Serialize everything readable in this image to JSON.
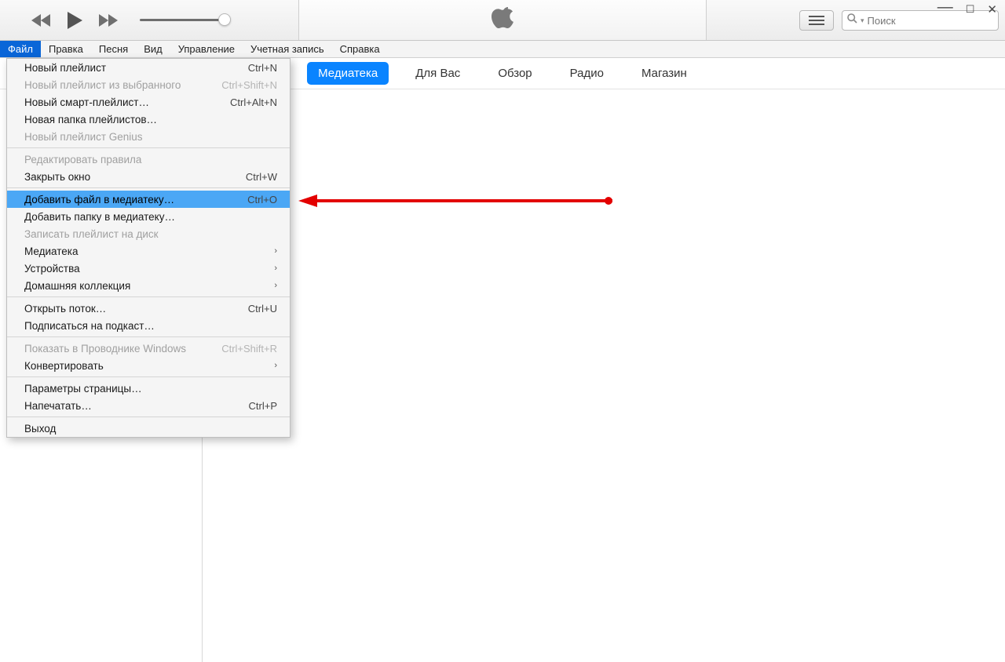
{
  "search": {
    "placeholder": "Поиск"
  },
  "menubar": [
    "Файл",
    "Правка",
    "Песня",
    "Вид",
    "Управление",
    "Учетная запись",
    "Справка"
  ],
  "menubar_active_index": 0,
  "tabs": [
    "Медиатека",
    "Для Вас",
    "Обзор",
    "Радио",
    "Магазин"
  ],
  "tabs_active_index": 0,
  "dropdown": [
    {
      "label": "Новый плейлист",
      "shortcut": "Ctrl+N"
    },
    {
      "label": "Новый плейлист из выбранного",
      "shortcut": "Ctrl+Shift+N",
      "disabled": true
    },
    {
      "label": "Новый смарт-плейлист…",
      "shortcut": "Ctrl+Alt+N"
    },
    {
      "label": "Новая папка плейлистов…"
    },
    {
      "label": "Новый плейлист Genius",
      "disabled": true
    },
    {
      "sep": true
    },
    {
      "label": "Редактировать правила",
      "disabled": true
    },
    {
      "label": "Закрыть окно",
      "shortcut": "Ctrl+W"
    },
    {
      "sep": true
    },
    {
      "label": "Добавить файл в медиатеку…",
      "shortcut": "Ctrl+O",
      "highlight": true
    },
    {
      "label": "Добавить папку в медиатеку…"
    },
    {
      "label": "Записать плейлист на диск",
      "disabled": true
    },
    {
      "label": "Медиатека",
      "submenu": true
    },
    {
      "label": "Устройства",
      "submenu": true
    },
    {
      "label": "Домашняя коллекция",
      "submenu": true
    },
    {
      "sep": true
    },
    {
      "label": "Открыть поток…",
      "shortcut": "Ctrl+U"
    },
    {
      "label": "Подписаться на подкаст…"
    },
    {
      "sep": true
    },
    {
      "label": "Показать в Проводнике Windows",
      "shortcut": "Ctrl+Shift+R",
      "disabled": true
    },
    {
      "label": "Конвертировать",
      "submenu": true
    },
    {
      "sep": true
    },
    {
      "label": "Параметры страницы…"
    },
    {
      "label": "Напечатать…",
      "shortcut": "Ctrl+P"
    },
    {
      "sep": true
    },
    {
      "label": "Выход"
    }
  ]
}
